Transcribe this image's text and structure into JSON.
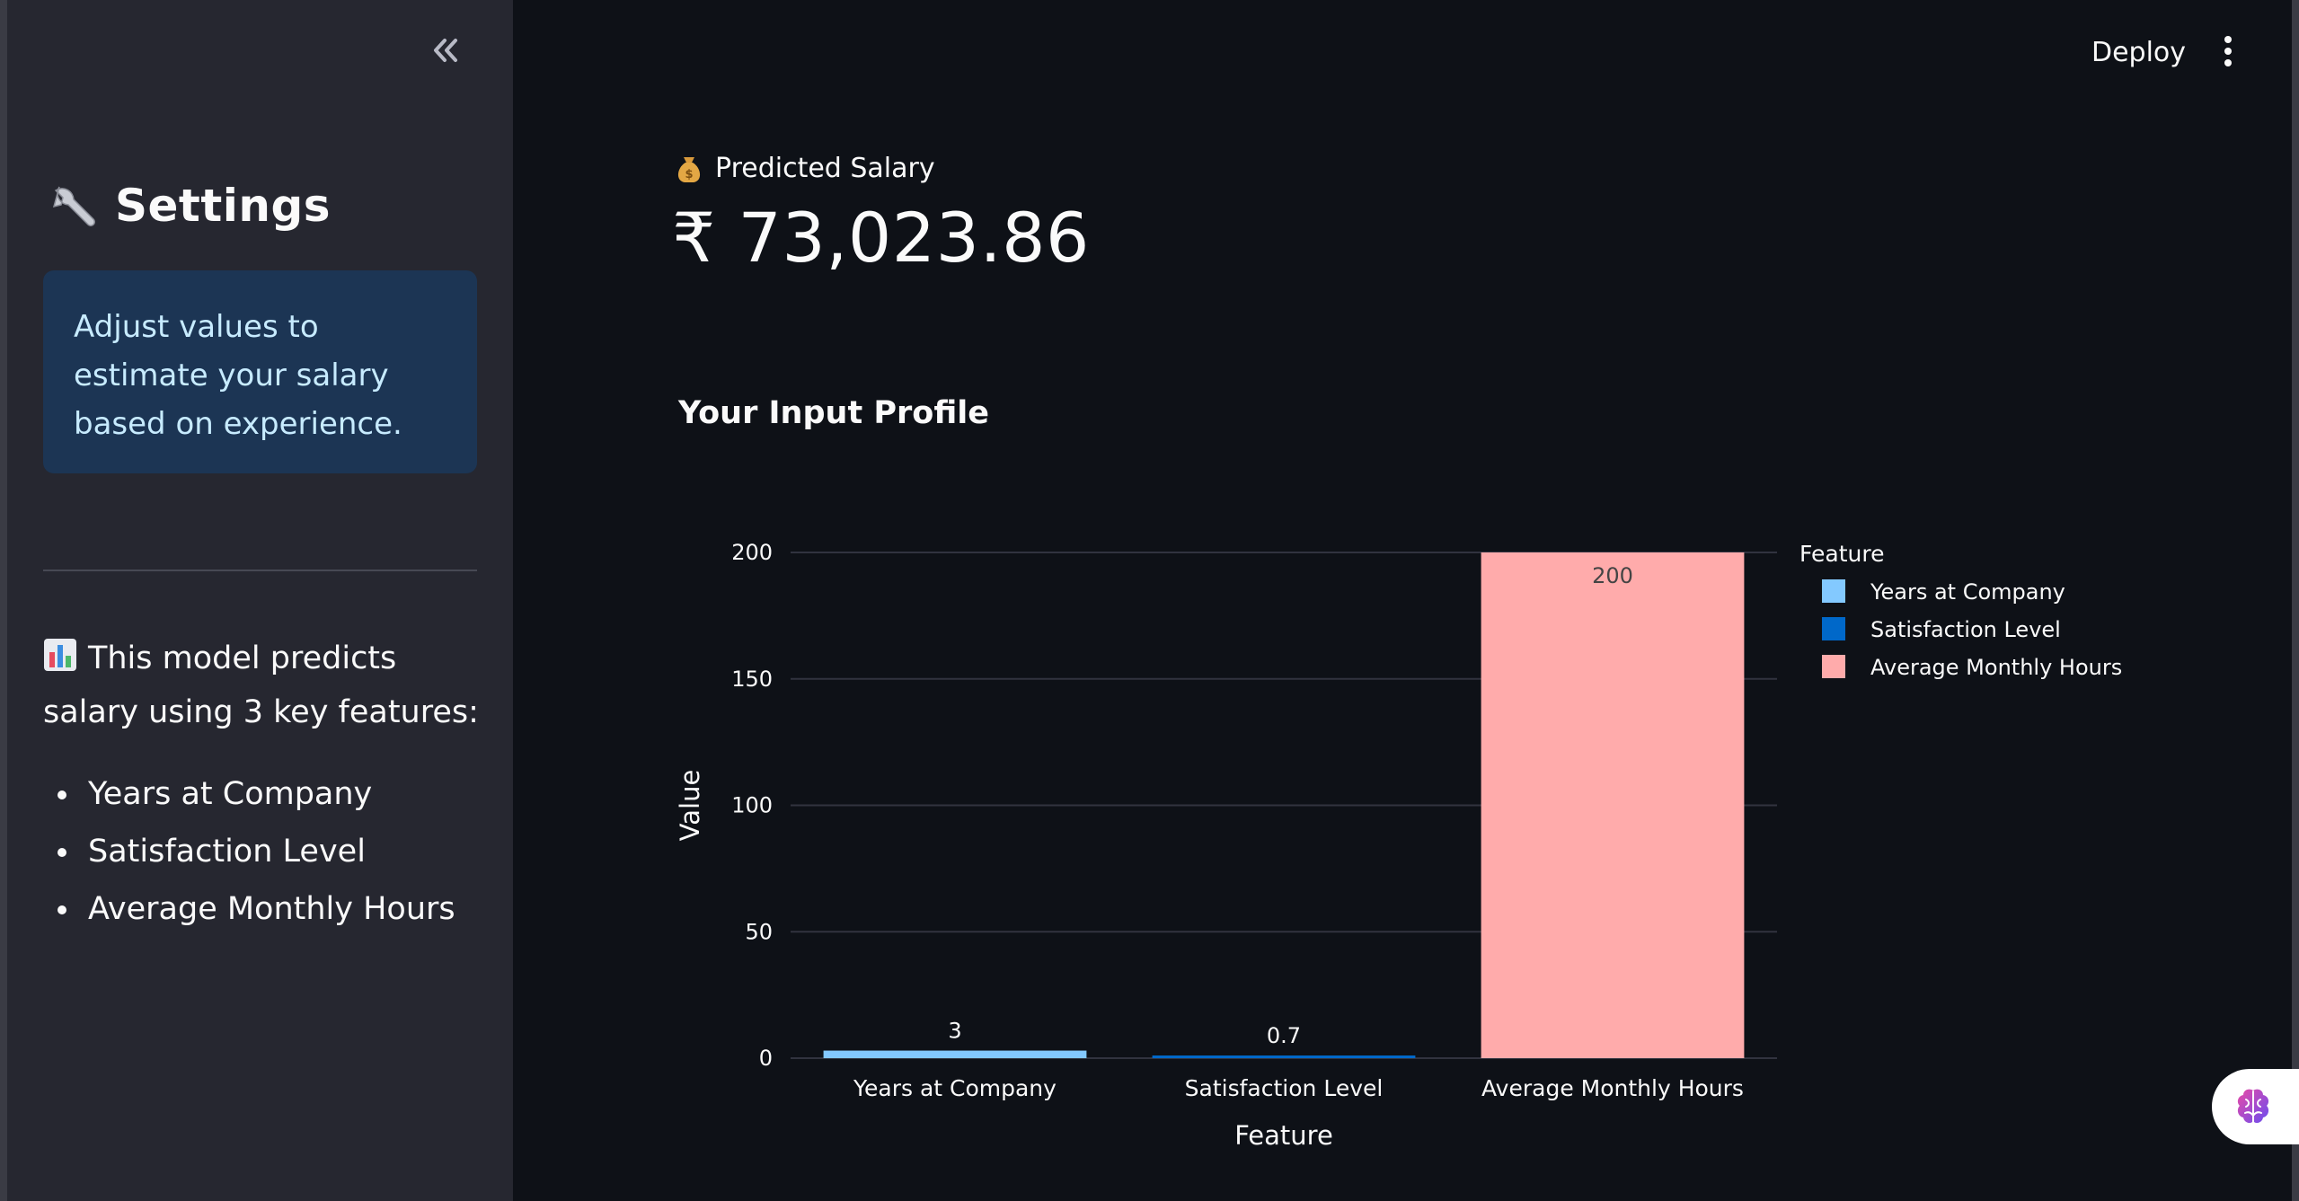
{
  "sidebar": {
    "title": "Settings",
    "info": "Adjust values to estimate your salary based on experience.",
    "model_text": "This model predicts salary using 3 key features:",
    "features": [
      "Years at Company",
      "Satisfaction Level",
      "Average Monthly Hours"
    ]
  },
  "header": {
    "deploy_label": "Deploy"
  },
  "metric": {
    "label": "Predicted Salary",
    "value": "₹ 73,023.86"
  },
  "section": {
    "title": "Your Input Profile"
  },
  "chart_data": {
    "type": "bar",
    "categories": [
      "Years at Company",
      "Satisfaction Level",
      "Average Monthly Hours"
    ],
    "values": [
      3,
      0.7,
      200
    ],
    "data_labels": [
      "3",
      "0.7",
      "200"
    ],
    "colors": [
      "#83c9ff",
      "#0068c9",
      "#ffabab"
    ],
    "xlabel": "Feature",
    "ylabel": "Value",
    "ylim": [
      0,
      200
    ],
    "yticks": [
      0,
      50,
      100,
      150,
      200
    ],
    "legend_title": "Feature",
    "legend_position": "top-right",
    "grid": true
  }
}
